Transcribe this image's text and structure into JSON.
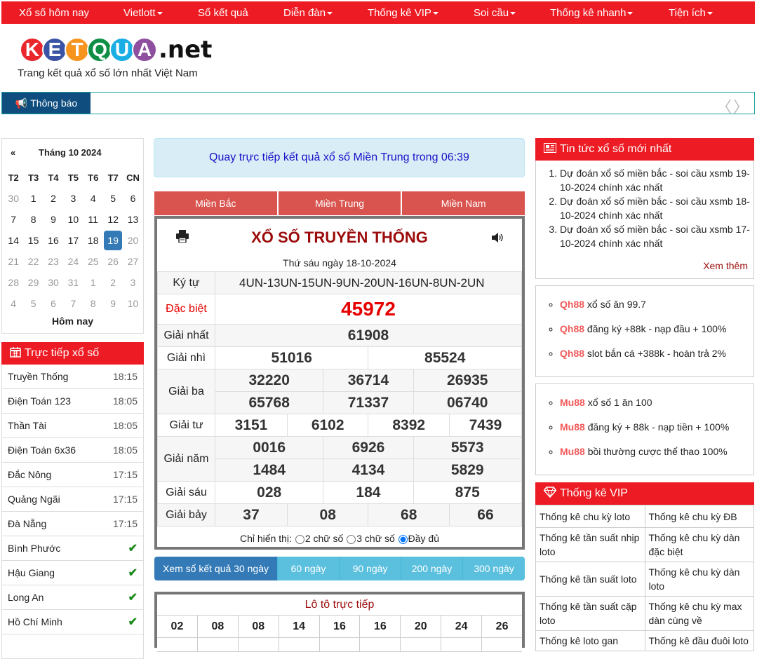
{
  "nav": {
    "items": [
      {
        "label": "Xổ số hôm nay",
        "dropdown": false
      },
      {
        "label": "Vietlott",
        "dropdown": true
      },
      {
        "label": "Sổ kết quả",
        "dropdown": false
      },
      {
        "label": "Diễn đàn",
        "dropdown": true
      },
      {
        "label": "Thống kê VIP",
        "dropdown": true
      },
      {
        "label": "Soi cầu",
        "dropdown": true
      },
      {
        "label": "Thống kê nhanh",
        "dropdown": true
      },
      {
        "label": "Tiện ích",
        "dropdown": true
      }
    ]
  },
  "logo": {
    "letters": [
      "K",
      "E",
      "T",
      "Q",
      "U",
      "A"
    ],
    "colors": [
      "#e8262c",
      "#3a53a4",
      "#f7941d",
      "#0f8f45",
      "#1aaee5",
      "#8e4f9f"
    ],
    "suffix": ".net",
    "tagline": "Trang kết quả xổ số lớn nhất Việt Nam"
  },
  "notice": {
    "label": "Thông báo",
    "arrows": "‹ ›"
  },
  "calendar": {
    "prev": "«",
    "title": "Tháng 10 2024",
    "weekdays": [
      "T2",
      "T3",
      "T4",
      "T5",
      "T6",
      "T7",
      "CN"
    ],
    "days": [
      {
        "d": "30",
        "m": true
      },
      {
        "d": "1"
      },
      {
        "d": "2"
      },
      {
        "d": "3"
      },
      {
        "d": "4"
      },
      {
        "d": "5"
      },
      {
        "d": "6"
      },
      {
        "d": "7"
      },
      {
        "d": "8"
      },
      {
        "d": "9"
      },
      {
        "d": "10"
      },
      {
        "d": "11"
      },
      {
        "d": "12"
      },
      {
        "d": "13"
      },
      {
        "d": "14"
      },
      {
        "d": "15"
      },
      {
        "d": "16"
      },
      {
        "d": "17"
      },
      {
        "d": "18"
      },
      {
        "d": "19",
        "sel": true
      },
      {
        "d": "20",
        "m": true
      },
      {
        "d": "21",
        "m": true
      },
      {
        "d": "22",
        "m": true
      },
      {
        "d": "23",
        "m": true
      },
      {
        "d": "24",
        "m": true
      },
      {
        "d": "25",
        "m": true
      },
      {
        "d": "26",
        "m": true
      },
      {
        "d": "27",
        "m": true
      },
      {
        "d": "28",
        "m": true
      },
      {
        "d": "29",
        "m": true
      },
      {
        "d": "30",
        "m": true
      },
      {
        "d": "31",
        "m": true
      },
      {
        "d": "1",
        "m": true
      },
      {
        "d": "2",
        "m": true
      },
      {
        "d": "3",
        "m": true
      },
      {
        "d": "4",
        "m": true
      },
      {
        "d": "5",
        "m": true
      },
      {
        "d": "6",
        "m": true
      },
      {
        "d": "7",
        "m": true
      },
      {
        "d": "8",
        "m": true
      },
      {
        "d": "9",
        "m": true
      },
      {
        "d": "10",
        "m": true
      }
    ],
    "today_label": "Hôm nay"
  },
  "live": {
    "title": "Trực tiếp xổ số",
    "items": [
      {
        "name": "Truyền Thống",
        "time": "18:15"
      },
      {
        "name": "Điện Toán 123",
        "time": "18:05"
      },
      {
        "name": "Thần Tài",
        "time": "18:05"
      },
      {
        "name": "Điện Toán 6x36",
        "time": "18:05"
      },
      {
        "name": "Đắc Nông",
        "time": "17:15"
      },
      {
        "name": "Quảng Ngãi",
        "time": "17:15"
      },
      {
        "name": "Đà Nẵng",
        "time": "17:15"
      },
      {
        "name": "Bình Phước",
        "done": true
      },
      {
        "name": "Hậu Giang",
        "done": true
      },
      {
        "name": "Long An",
        "done": true
      },
      {
        "name": "Hồ Chí Minh",
        "done": true
      }
    ]
  },
  "alert": "Quay trực tiếp kết quả xổ số Miền Trung trong 06:39",
  "regions": [
    "Miền Bắc",
    "Miền Trung",
    "Miền Nam"
  ],
  "result": {
    "title": "XỔ SỐ TRUYỀN THỐNG",
    "date": "Thứ sáu ngày 18-10-2024",
    "kytu_label": "Ký tự",
    "kytu": "4UN-13UN-15UN-9UN-20UN-16UN-8UN-2UN",
    "prizes": {
      "db": {
        "label": "Đặc biệt",
        "values": [
          "45972"
        ]
      },
      "g1": {
        "label": "Giải nhất",
        "values": [
          "61908"
        ]
      },
      "g2": {
        "label": "Giải nhì",
        "values": [
          "51016",
          "85524"
        ]
      },
      "g3": {
        "label": "Giải ba",
        "values": [
          "32220",
          "36714",
          "26935",
          "65768",
          "71337",
          "06740"
        ]
      },
      "g4": {
        "label": "Giải tư",
        "values": [
          "3151",
          "6102",
          "8392",
          "7439"
        ]
      },
      "g5": {
        "label": "Giải năm",
        "values": [
          "0016",
          "6926",
          "5573",
          "1484",
          "4134",
          "5829"
        ]
      },
      "g6": {
        "label": "Giải sáu",
        "values": [
          "028",
          "184",
          "875"
        ]
      },
      "g7": {
        "label": "Giải bảy",
        "values": [
          "37",
          "08",
          "68",
          "66"
        ]
      }
    },
    "filter": {
      "label": "Chỉ hiển thị:",
      "options": [
        "2 chữ số",
        "3 chữ số",
        "Đầy đủ"
      ],
      "selected": "Đầy đủ"
    }
  },
  "day_buttons": [
    "Xem sổ kết quả 30 ngày",
    "60 ngày",
    "90 ngày",
    "200 ngày",
    "300 ngày"
  ],
  "loto": {
    "title": "Lô tô trực tiếp",
    "row1": [
      "02",
      "08",
      "08",
      "14",
      "16",
      "16",
      "20",
      "24",
      "26"
    ]
  },
  "news": {
    "title": "Tin tức xổ số mới nhất",
    "items": [
      "Dự đoán xổ số miền bắc - soi cầu xsmb 19-10-2024 chính xác nhất",
      "Dự đoán xổ số miền bắc - soi cầu xsmb 18-10-2024 chính xác nhất",
      "Dự đoán xổ số miền bắc - soi cầu xsmb 17-10-2024 chính xác nhất"
    ],
    "more": "Xem thêm"
  },
  "promo1": [
    {
      "brand": "Qh88",
      "text": "xổ số ăn 99.7"
    },
    {
      "brand": "Qh88",
      "text": "đăng ký +88k - nạp đầu + 100%"
    },
    {
      "brand": "Qh88",
      "text": "slot bắn cá +388k - hoàn trả 2%"
    }
  ],
  "promo2": [
    {
      "brand": "Mu88",
      "text": "xổ số 1 ăn 100"
    },
    {
      "brand": "Mu88",
      "text": "đăng ký + 88k - nạp tiền + 100%"
    },
    {
      "brand": "Mu88",
      "text": "bồi thường cược thể thao 100%"
    }
  ],
  "vip": {
    "title": "Thống kê VIP",
    "rows": [
      [
        "Thống kê chu kỳ loto",
        "Thống kê chu kỳ ĐB"
      ],
      [
        "Thống kê tần suất nhịp loto",
        "Thống kê chu kỳ dàn đặc biệt"
      ],
      [
        "Thống kê tần suất loto",
        "Thống kê chu kỳ dàn loto"
      ],
      [
        "Thống kê tần suất cặp loto",
        "Thống kê chu kỳ max dàn cùng về"
      ],
      [
        "Thống kê loto gan",
        "Thống kê đầu đuôi loto"
      ]
    ]
  },
  "colors": {
    "brand_red": "#ed1c24",
    "notice_blue": "#0e4d7d",
    "region_tab": "#d9534f",
    "special_red": "#e60000",
    "title_dark_red": "#9b0b0b"
  }
}
